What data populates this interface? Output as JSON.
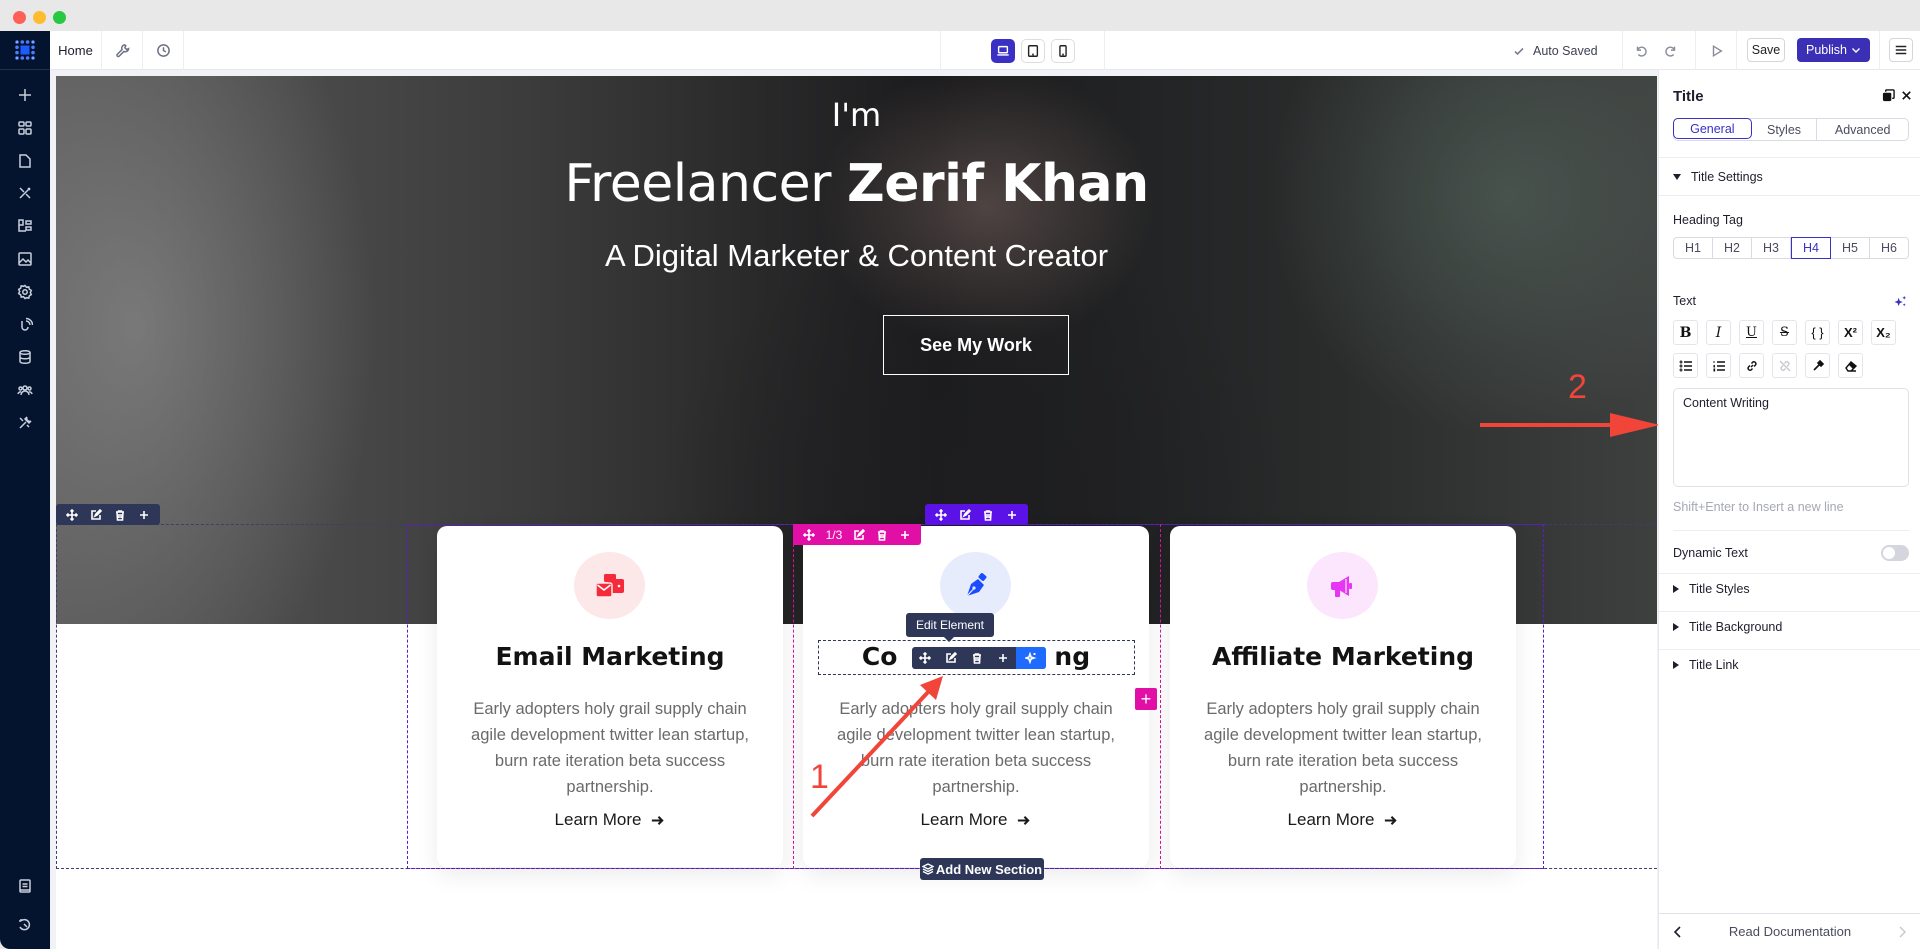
{
  "window": {
    "controls": [
      "close",
      "minimize",
      "maximize"
    ]
  },
  "topbar": {
    "page_name": "Home",
    "icons": [
      "wrench-icon",
      "history-icon"
    ],
    "devices": [
      {
        "name": "desktop",
        "active": true
      },
      {
        "name": "tablet",
        "active": false
      },
      {
        "name": "mobile",
        "active": false
      }
    ],
    "status": "Auto Saved",
    "save_label": "Save",
    "publish_label": "Publish"
  },
  "sidebar": {
    "items": [
      "add",
      "widgets",
      "pages",
      "design",
      "structure",
      "media",
      "settings",
      "integrations",
      "database",
      "users",
      "tools"
    ],
    "bottom_items": [
      "docs",
      "history"
    ]
  },
  "hero": {
    "intro": "I'm",
    "title_light": "Freelancer ",
    "title_bold": "Zerif Khan",
    "subtitle": "A Digital Marketer & Content Creator",
    "button": "See My Work"
  },
  "cards": [
    {
      "icon": "email-marketing-icon",
      "title": "Email Marketing",
      "text": "Early adopters holy grail supply chain agile development twitter lean startup, burn rate iteration beta success partnership.",
      "link": "Learn More",
      "icon_color": "#f52a3a",
      "icon_bg": "#fde8e9"
    },
    {
      "icon": "pen-nib-icon",
      "title": "Content Writing",
      "text": "Early adopters holy grail supply chain agile development twitter lean startup, burn rate iteration beta success partnership.",
      "link": "Learn More",
      "icon_color": "#1b4dff",
      "icon_bg": "#e7ecfd"
    },
    {
      "icon": "megaphone-icon",
      "title": "Affiliate Marketing",
      "text": "Early adopters holy grail supply chain agile development twitter lean startup, burn rate iteration beta success partnership.",
      "link": "Learn More",
      "icon_color": "#e636f3",
      "icon_bg": "#fbe6fd"
    }
  ],
  "editor_overlays": {
    "column_counter": "1/3",
    "tooltip": "Edit Element",
    "add_section": "Add New Section",
    "visible_title_left": "Co",
    "visible_title_right": "ng"
  },
  "annotations": [
    {
      "label": "1",
      "target": "edit-element-button"
    },
    {
      "label": "2",
      "target": "text-content-field"
    }
  ],
  "panel": {
    "title": "Title",
    "tabs": [
      {
        "label": "General",
        "active": true
      },
      {
        "label": "Styles",
        "active": false
      },
      {
        "label": "Advanced",
        "active": false
      }
    ],
    "section_title": "Title Settings",
    "heading_tag_label": "Heading Tag",
    "heading_tags": [
      {
        "label": "H1",
        "active": false
      },
      {
        "label": "H2",
        "active": false
      },
      {
        "label": "H3",
        "active": false
      },
      {
        "label": "H4",
        "active": true
      },
      {
        "label": "H5",
        "active": false
      },
      {
        "label": "H6",
        "active": false
      }
    ],
    "text_label": "Text",
    "text_value": "Content Writing",
    "hint": "Shift+Enter to Insert a new line",
    "dynamic_text_label": "Dynamic Text",
    "dynamic_text_enabled": false,
    "collapsed_sections": [
      "Title Styles",
      "Title Background",
      "Title Link"
    ],
    "footer_label": "Read Documentation"
  },
  "colors": {
    "accent": "#3a31c4",
    "publish": "#3a2fb5",
    "column": "#e10fa6",
    "container": "#5a12e6",
    "annotation": "#f1453a"
  }
}
